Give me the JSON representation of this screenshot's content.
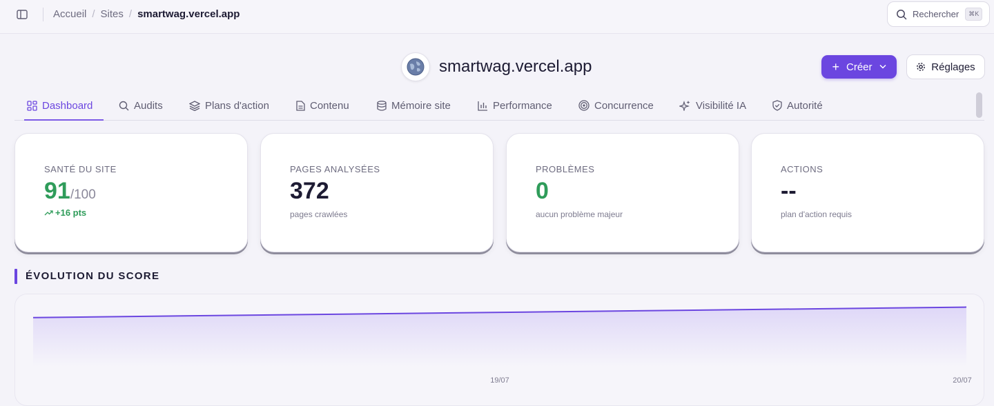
{
  "breadcrumb": {
    "items": [
      "Accueil",
      "Sites"
    ],
    "current": "smartwag.vercel.app"
  },
  "search": {
    "label": "Rechercher",
    "shortcut": "⌘K"
  },
  "site": {
    "title": "smartwag.vercel.app"
  },
  "actions": {
    "create_label": "Créer",
    "settings_label": "Réglages"
  },
  "tabs": [
    {
      "label": "Dashboard",
      "icon": "layout-dashboard-icon",
      "active": true
    },
    {
      "label": "Audits",
      "icon": "search-icon"
    },
    {
      "label": "Plans d'action",
      "icon": "layers-icon"
    },
    {
      "label": "Contenu",
      "icon": "file-text-icon"
    },
    {
      "label": "Mémoire site",
      "icon": "database-icon"
    },
    {
      "label": "Performance",
      "icon": "bar-chart-icon"
    },
    {
      "label": "Concurrence",
      "icon": "target-icon"
    },
    {
      "label": "Visibilité IA",
      "icon": "sparkles-icon"
    },
    {
      "label": "Autorité",
      "icon": "shield-icon"
    }
  ],
  "cards": {
    "health": {
      "title": "SANTÉ DU SITE",
      "value": "91",
      "suffix": "/100",
      "trend": "+16 pts"
    },
    "pages": {
      "title": "PAGES ANALYSÉES",
      "value": "372",
      "sub": "pages crawlées"
    },
    "problems": {
      "title": "PROBLÈMES",
      "value": "0",
      "sub": "aucun problème majeur"
    },
    "actions": {
      "title": "ACTIONS",
      "value": "--",
      "sub": "plan d'action requis"
    }
  },
  "section": {
    "title": "ÉVOLUTION DU SCORE"
  },
  "colors": {
    "accent": "#6b46e0",
    "success": "#2f9c5a"
  },
  "chart_data": {
    "type": "area",
    "x": [
      "19/07",
      "20/07"
    ],
    "tick_labels": [
      "19/07",
      "20/07"
    ],
    "series": [
      {
        "values": [
          75,
          91
        ]
      }
    ],
    "ylim": [
      0,
      100
    ],
    "grid": false
  }
}
